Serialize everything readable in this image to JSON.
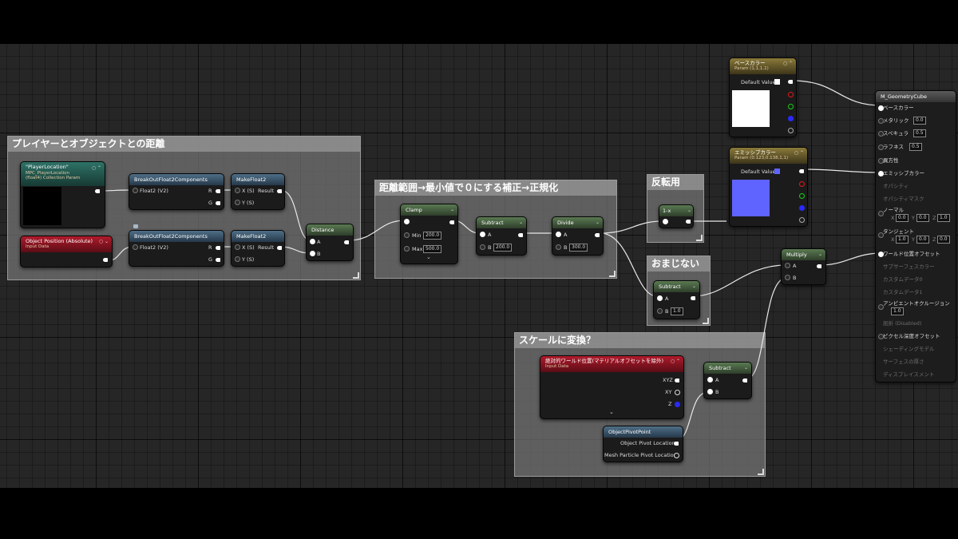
{
  "comments": {
    "player_distance": "プレイヤーとオブジェクトとの距離",
    "distance_range": "距離範囲→最小値で０にする補正→正規化",
    "invert": "反転用",
    "charm": "おまじない",
    "scale": "スケールに変換？"
  },
  "nodes": {
    "player_location": {
      "title": "\"PlayerLocation\"",
      "sub1": "MPC_PlayerLocation",
      "sub2": "(float4) Collection Param"
    },
    "object_position": {
      "title": "Object Position  (Absolute)",
      "sub": "Input Data"
    },
    "break1": {
      "title": "BreakOutFloat2Components",
      "input": "Float2 (V2)",
      "r": "R",
      "g": "G"
    },
    "break2": {
      "title": "BreakOutFloat2Components",
      "input": "Float2 (V2)",
      "r": "R",
      "g": "G"
    },
    "make1": {
      "title": "MakeFloat2",
      "x": "X (S)",
      "y": "Y (S)",
      "out": "Result"
    },
    "make2": {
      "title": "MakeFloat2",
      "x": "X (S)",
      "y": "Y (S)",
      "out": "Result"
    },
    "distance": {
      "title": "Distance",
      "a": "A",
      "b": "B"
    },
    "clamp": {
      "title": "Clamp",
      "min": "Min",
      "min_val": "200.0",
      "max": "Max",
      "max_val": "500.0"
    },
    "subtract1": {
      "title": "Subtract",
      "a": "A",
      "b": "B",
      "b_val": "200.0"
    },
    "divide": {
      "title": "Divide",
      "a": "A",
      "b": "B",
      "b_val": "300.0"
    },
    "one_minus": {
      "title": "1-x"
    },
    "subtract2": {
      "title": "Subtract",
      "a": "A",
      "b": "B",
      "b_val": "1.0"
    },
    "multiply": {
      "title": "Multiply",
      "a": "A",
      "b": "B"
    },
    "base_color": {
      "title": "ベースカラー",
      "sub": "Param (1,1,1,1)",
      "default": "Default Value"
    },
    "emissive_color": {
      "title": "エミッシブカラー",
      "sub": "Param (0.123,0.138,1,1)",
      "default": "Default Value"
    },
    "world_pos": {
      "title": "絶対的ワールド位置(マテリアルオフセットを除外)",
      "sub": "Input Data",
      "xyz": "XYZ",
      "xy": "XY",
      "z": "Z"
    },
    "subtract3": {
      "title": "Subtract",
      "a": "A",
      "b": "B"
    },
    "pivot": {
      "title": "ObjectPivotPoint",
      "out1": "Object Pivot Location",
      "out2": "Mesh Particle Pivot Location"
    }
  },
  "result": {
    "title": "M_GeometryCube",
    "base_color": "ベースカラー",
    "metallic": "メタリック",
    "metallic_val": "0.0",
    "specular": "スペキュラ",
    "specular_val": "0.5",
    "roughness": "ラフネス",
    "roughness_val": "0.5",
    "anisotropy": "異方性",
    "emissive": "エミッシブカラー",
    "opacity": "オパシティ",
    "opacity_mask": "オパシティマスク",
    "normal": "ノーマル",
    "normal_x": "0.0",
    "normal_y": "0.0",
    "normal_z": "1.0",
    "tangent": "タンジェント",
    "tangent_x": "1.0",
    "tangent_y": "0.0",
    "tangent_z": "0.0",
    "wpo": "ワールド位置オフセット",
    "subsurface": "サブサーフェスカラー",
    "custom0": "カスタムデータ0",
    "custom1": "カスタムデータ1",
    "ao": "アンビエントオクルージョン",
    "ao_val": "1.0",
    "refraction": "屈折 (Disabled)",
    "pixel_depth": "ピクセル深度オフセット",
    "shading_model": "シェーディングモデル",
    "thickness": "サーフェスの厚さ",
    "displacement": "ディスプレイスメント",
    "x": "X",
    "y": "Y",
    "z": "Z"
  },
  "colors": {
    "base_swatch": "#ffffff",
    "emissive_swatch": "#5f63ff",
    "wire": "#e8e8e8",
    "pin_red": "#e01919",
    "pin_green": "#19d019",
    "pin_blue": "#2a2aff"
  }
}
